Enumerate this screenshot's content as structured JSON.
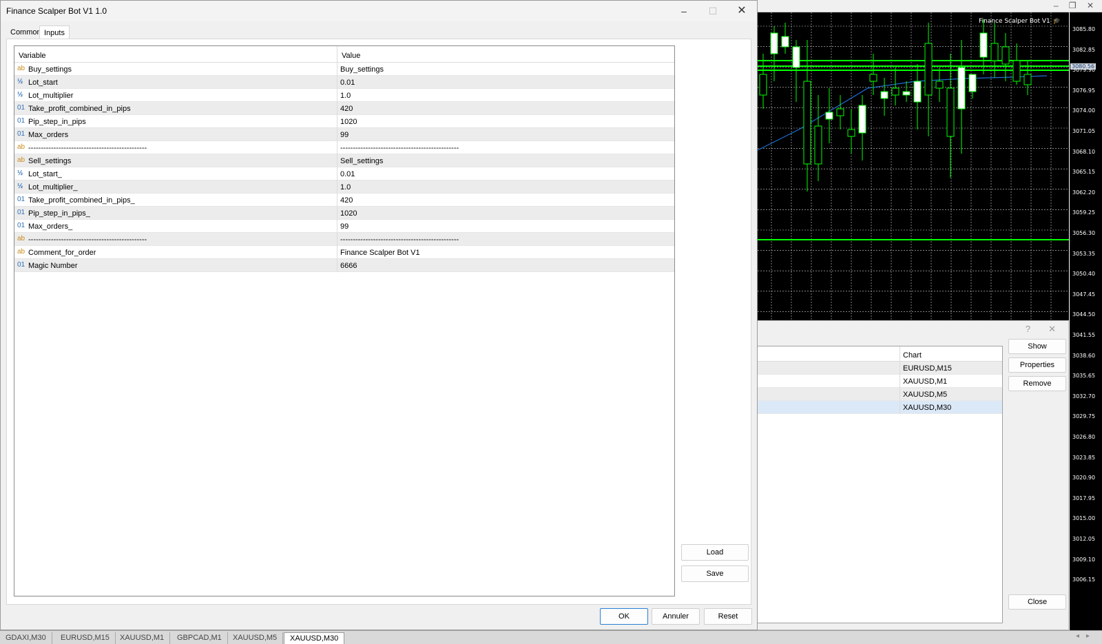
{
  "dialog": {
    "title": "Finance Scalper Bot V1 1.0",
    "tabs": [
      "Common",
      "Inputs"
    ],
    "active_tab": "Inputs",
    "grid": {
      "columns": [
        "Variable",
        "Value"
      ],
      "rows": [
        {
          "type": "ab",
          "variable": "Buy_settings",
          "value": "Buy_settings"
        },
        {
          "type": "half",
          "variable": "Lot_start",
          "value": "0.01"
        },
        {
          "type": "half",
          "variable": "Lot_multiplier",
          "value": "1.0"
        },
        {
          "type": "01",
          "variable": "Take_profit_combined_in_pips",
          "value": "420"
        },
        {
          "type": "01",
          "variable": "Pip_step_in_pips",
          "value": "1020"
        },
        {
          "type": "01",
          "variable": "Max_orders",
          "value": "99"
        },
        {
          "type": "ab",
          "variable": "-----------------------------------------------",
          "value": "-----------------------------------------------"
        },
        {
          "type": "ab",
          "variable": "Sell_settings",
          "value": "Sell_settings"
        },
        {
          "type": "half",
          "variable": "Lot_start_",
          "value": "0.01"
        },
        {
          "type": "half",
          "variable": "Lot_multiplier_",
          "value": "1.0"
        },
        {
          "type": "01",
          "variable": "Take_profit_combined_in_pips_",
          "value": "420"
        },
        {
          "type": "01",
          "variable": "Pip_step_in_pips_",
          "value": "1020"
        },
        {
          "type": "01",
          "variable": "Max_orders_",
          "value": "99"
        },
        {
          "type": "ab",
          "variable": "-----------------------------------------------",
          "value": "-----------------------------------------------"
        },
        {
          "type": "ab",
          "variable": "Comment_for_order",
          "value": "Finance Scalper Bot V1"
        },
        {
          "type": "01",
          "variable": "Magic Number",
          "value": "6666"
        }
      ]
    },
    "side_buttons": {
      "load": "Load",
      "save": "Save"
    },
    "buttons": {
      "ok": "OK",
      "cancel": "Annuler",
      "reset": "Reset"
    }
  },
  "experts": {
    "column": "Chart",
    "rows": [
      "EURUSD,M15",
      "XAUUSD,M1",
      "XAUUSD,M5",
      "XAUUSD,M30"
    ],
    "selected_index": 3,
    "buttons": {
      "show": "Show",
      "properties": "Properties",
      "remove": "Remove",
      "close": "Close"
    }
  },
  "chart": {
    "caption": "Finance Scalper Bot V1",
    "current_price": "3080.56",
    "price_labels": [
      "3085.80",
      "3082.85",
      "3079.90",
      "3076.95",
      "3074.00",
      "3071.05",
      "3068.10",
      "3065.15",
      "3062.20",
      "3059.25",
      "3056.30",
      "3053.35",
      "3050.40",
      "3047.45",
      "3044.50",
      "3041.55",
      "3038.60",
      "3035.65",
      "3032.70",
      "3029.75",
      "3026.80",
      "3023.85",
      "3020.90",
      "3017.95",
      "3015.00",
      "3012.05",
      "3009.10",
      "3006.15"
    ],
    "colors": {
      "bull": "#ffffff",
      "bear": "#000000",
      "wick": "#00ff00",
      "grid": "#d8d8d8",
      "line": "#1f6fd6"
    }
  },
  "chart_tabs": [
    "GDAXI,M30",
    "EURUSD,M15",
    "XAUUSD,M1",
    "GBPCAD,M1",
    "XAUUSD,M5",
    "XAUUSD,M30"
  ],
  "active_chart_tab": "XAUUSD,M30"
}
